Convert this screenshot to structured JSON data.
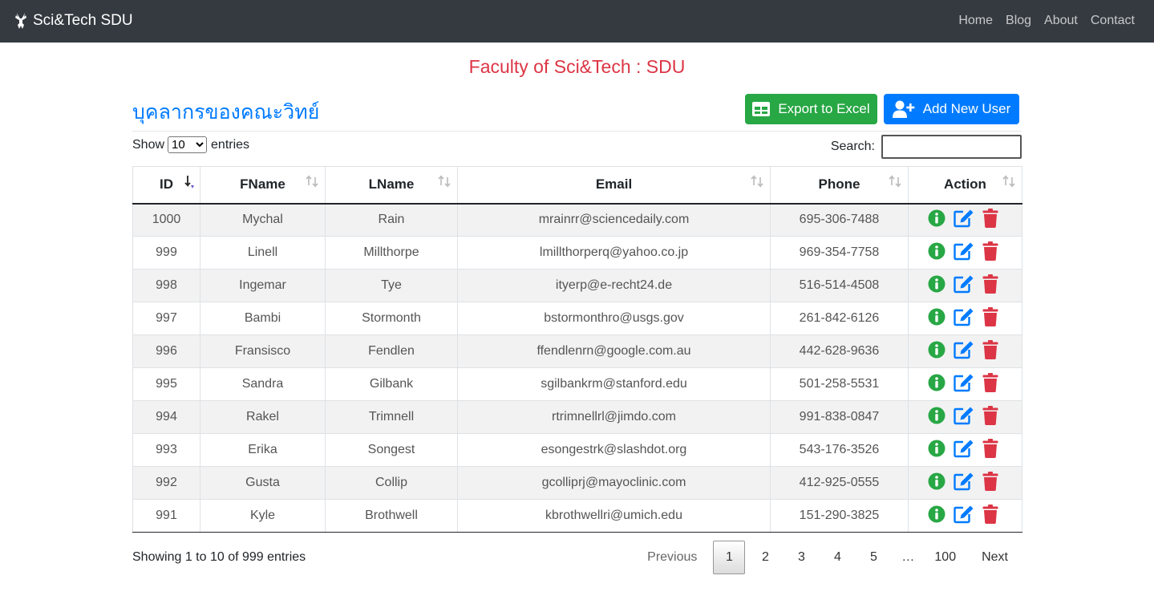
{
  "navbar": {
    "brand": "Sci&Tech SDU",
    "links": [
      "Home",
      "Blog",
      "About",
      "Contact"
    ]
  },
  "page_title": "Faculty of Sci&Tech : SDU",
  "section_title": "บุคลากรของคณะวิทย์",
  "buttons": {
    "export": "Export to Excel",
    "add_user": "Add New User"
  },
  "length": {
    "show_label": "Show",
    "value": "10",
    "entries_label": "entries"
  },
  "search": {
    "label": "Search:",
    "value": ""
  },
  "table": {
    "headers": [
      "ID",
      "FName",
      "LName",
      "Email",
      "Phone",
      "Action"
    ],
    "rows": [
      [
        "1000",
        "Mychal",
        "Rain",
        "mrainrr@sciencedaily.com",
        "695-306-7488"
      ],
      [
        "999",
        "Linell",
        "Millthorpe",
        "lmillthorperq@yahoo.co.jp",
        "969-354-7758"
      ],
      [
        "998",
        "Ingemar",
        "Tye",
        "ityerp@e-recht24.de",
        "516-514-4508"
      ],
      [
        "997",
        "Bambi",
        "Stormonth",
        "bstormonthro@usgs.gov",
        "261-842-6126"
      ],
      [
        "996",
        "Fransisco",
        "Fendlen",
        "ffendlenrn@google.com.au",
        "442-628-9636"
      ],
      [
        "995",
        "Sandra",
        "Gilbank",
        "sgilbankrm@stanford.edu",
        "501-258-5531"
      ],
      [
        "994",
        "Rakel",
        "Trimnell",
        "rtrimnellrl@jimdo.com",
        "991-838-0847"
      ],
      [
        "993",
        "Erika",
        "Songest",
        "esongestrk@slashdot.org",
        "543-176-3526"
      ],
      [
        "992",
        "Gusta",
        "Collip",
        "gcolliprj@mayoclinic.com",
        "412-925-0555"
      ],
      [
        "991",
        "Kyle",
        "Brothwell",
        "kbrothwellri@umich.edu",
        "151-290-3825"
      ]
    ]
  },
  "info": "Showing 1 to 10 of 999 entries",
  "pagination": {
    "previous": "Previous",
    "pages": [
      "1",
      "2",
      "3",
      "4",
      "5",
      "…",
      "100"
    ],
    "next": "Next",
    "current": "1"
  },
  "colors": {
    "navbar": "#343a40",
    "title": "#dc3545",
    "primary": "#007bff",
    "success": "#28a745",
    "danger": "#dc3545"
  },
  "icons": {
    "brand": "deer-logo-icon",
    "export": "table-icon",
    "add_user": "user-plus-icon",
    "row_actions": [
      "info-circle-icon",
      "edit-icon",
      "trash-icon"
    ]
  }
}
